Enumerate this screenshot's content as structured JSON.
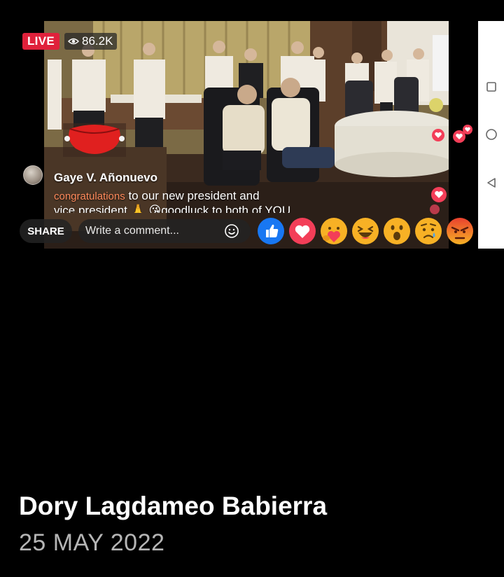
{
  "video": {
    "live_label": "LIVE",
    "viewer_count": "86.2K"
  },
  "comment": {
    "author": "Gaye V. Añonuevo",
    "tag": "congratulations",
    "text_main": " to our new president and",
    "text_line2": "vice president 🙏 😘goodluck to both of YOU"
  },
  "composer": {
    "share_label": "SHARE",
    "input_placeholder": "Write a comment..."
  },
  "reactions": [
    "like",
    "love",
    "care",
    "haha",
    "wow",
    "sad",
    "angry"
  ],
  "post": {
    "author": "Dory Lagdameo Babierra",
    "date": "25 MAY 2022"
  },
  "colors": {
    "live": "#e0213b",
    "like": "#1877f2",
    "love": "#f33e58"
  }
}
